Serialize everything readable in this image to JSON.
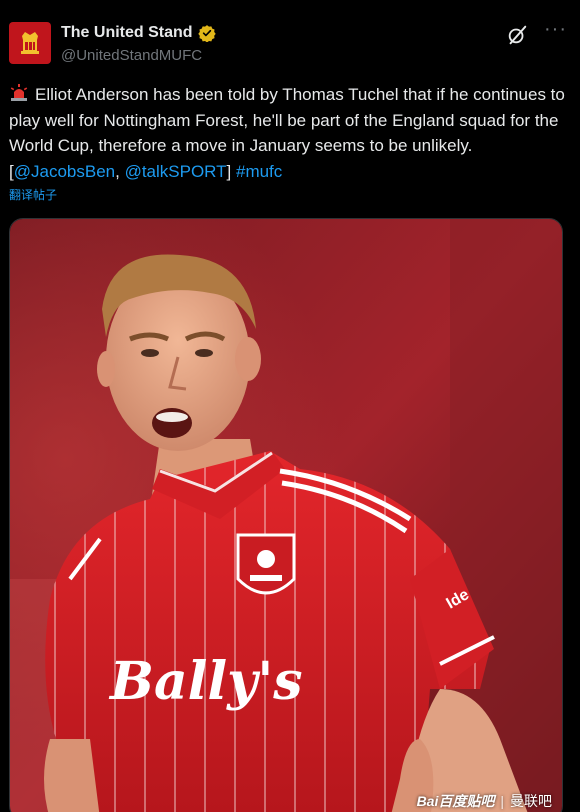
{
  "author": {
    "display_name": "The United Stand",
    "handle": "@UnitedStandMUFC",
    "avatar_icon": "united-stand-crest-icon",
    "verified_icon": "verified-badge-icon"
  },
  "actions": {
    "grok_icon": "grok-icon",
    "more_label": "···"
  },
  "tweet": {
    "text_before": "Elliot Anderson has been told by Thomas Tuchel that if he continues to play well for Nottingham Forest, he'll be part of the England squad for the World Cup, therefore a move in January seems to be unlikely. [",
    "mention1": "@JacobsBen",
    "comma": ", ",
    "mention2": "@talkSPORT",
    "close_bracket": "] ",
    "hashtag": "#mufc",
    "siren_icon": "police-light-emoji"
  },
  "translate_label": "翻译帖子",
  "media": {
    "description_icon": "player-photo",
    "watermark_logo": "Bai百度贴吧",
    "watermark_sep": "|",
    "watermark_text": "曼联吧"
  },
  "colors": {
    "accent": "#1d9bf0",
    "background": "#000000",
    "text": "#e7e9ea",
    "secondary": "#71767b",
    "verified": "#e2b719"
  }
}
